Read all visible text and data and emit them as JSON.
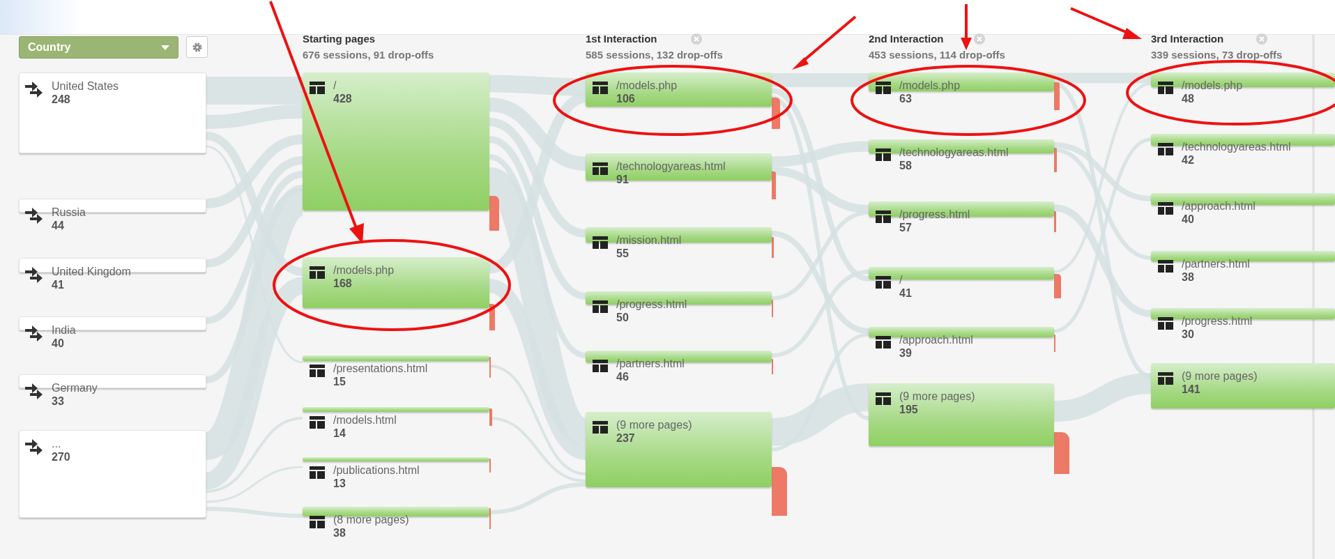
{
  "dimension_selector": {
    "value": "Country"
  },
  "countries": [
    {
      "name": "United States",
      "count": "248"
    },
    {
      "name": "Russia",
      "count": "44"
    },
    {
      "name": "United Kingdom",
      "count": "41"
    },
    {
      "name": "India",
      "count": "40"
    },
    {
      "name": "Germany",
      "count": "33"
    },
    {
      "name": "...",
      "count": "270"
    }
  ],
  "columns": [
    {
      "title": "Starting pages",
      "summary": "676 sessions, 91 drop-offs",
      "removable": false,
      "nodes": [
        {
          "page": "/",
          "count": "428"
        },
        {
          "page": "/models.php",
          "count": "168"
        },
        {
          "page": "/presentations.html",
          "count": "15"
        },
        {
          "page": "/models.html",
          "count": "14"
        },
        {
          "page": "/publications.html",
          "count": "13"
        },
        {
          "page": "(8 more pages)",
          "count": "38"
        }
      ]
    },
    {
      "title": "1st Interaction",
      "summary": "585 sessions, 132 drop-offs",
      "removable": true,
      "nodes": [
        {
          "page": "/models.php",
          "count": "106"
        },
        {
          "page": "/technologyareas.html",
          "count": "91"
        },
        {
          "page": "/mission.html",
          "count": "55"
        },
        {
          "page": "/progress.html",
          "count": "50"
        },
        {
          "page": "/partners.html",
          "count": "46"
        },
        {
          "page": "(9 more pages)",
          "count": "237"
        }
      ]
    },
    {
      "title": "2nd Interaction",
      "summary": "453 sessions, 114 drop-offs",
      "removable": true,
      "nodes": [
        {
          "page": "/models.php",
          "count": "63"
        },
        {
          "page": "/technologyareas.html",
          "count": "58"
        },
        {
          "page": "/progress.html",
          "count": "57"
        },
        {
          "page": "/",
          "count": "41"
        },
        {
          "page": "/approach.html",
          "count": "39"
        },
        {
          "page": "(9 more pages)",
          "count": "195"
        }
      ]
    },
    {
      "title": "3rd Interaction",
      "summary": "339 sessions, 73 drop-offs",
      "removable": true,
      "nodes": [
        {
          "page": "/models.php",
          "count": "48"
        },
        {
          "page": "/technologyareas.html",
          "count": "42"
        },
        {
          "page": "/approach.html",
          "count": "40"
        },
        {
          "page": "/partners.html",
          "count": "38"
        },
        {
          "page": "/progress.html",
          "count": "30"
        },
        {
          "page": "(9 more pages)",
          "count": "141"
        }
      ]
    }
  ]
}
